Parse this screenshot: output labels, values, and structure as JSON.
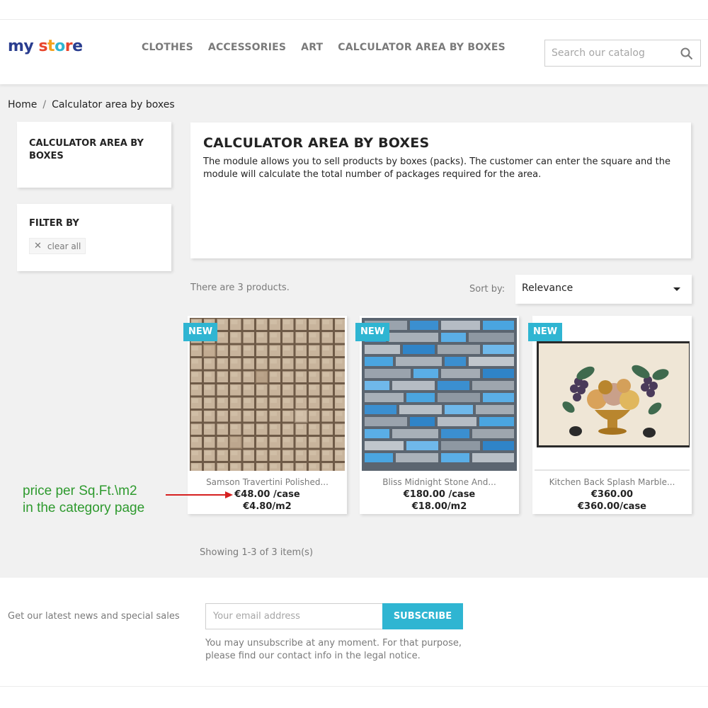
{
  "header": {
    "logo_word1": "my",
    "logo_word2": "store",
    "nav": [
      "CLOTHES",
      "ACCESSORIES",
      "ART",
      "CALCULATOR AREA BY BOXES"
    ],
    "search_placeholder": "Search our catalog"
  },
  "breadcrumb": {
    "home": "Home",
    "separator": "/",
    "current": "Calculator area by boxes"
  },
  "sidebar": {
    "category_title": "CALCULATOR AREA BY BOXES",
    "filter_title": "FILTER BY",
    "clear_all": "clear all"
  },
  "category": {
    "title": "CALCULATOR AREA BY BOXES",
    "description": "The module allows you to sell products by boxes (packs). The customer can enter the square and the module will calculate the total number of packages required for the area."
  },
  "listing": {
    "count_text": "There are 3 products.",
    "sort_label": "Sort by:",
    "sort_value": "Relevance",
    "showing_text": "Showing 1-3 of 3 item(s)"
  },
  "products": [
    {
      "badge": "NEW",
      "name": "Samson Travertini Polished...",
      "price": "€48.00 /case",
      "unit_price": "€4.80/m2"
    },
    {
      "badge": "NEW",
      "name": "Bliss Midnight Stone And...",
      "price": "€180.00 /case",
      "unit_price": "€18.00/m2"
    },
    {
      "badge": "NEW",
      "name": "Kitchen Back Splash Marble...",
      "price": "€360.00",
      "unit_price": "€360.00/case"
    }
  ],
  "annotation": {
    "line1": "price per Sq.Ft.\\m2",
    "line2": "in the category page"
  },
  "footer": {
    "newsletter_label": "Get our latest news and special sales",
    "email_placeholder": "Your email address",
    "subscribe_label": "SUBSCRIBE",
    "unsubscribe_text": "You may unsubscribe at any moment. For that purpose, please find our contact info in the legal notice."
  },
  "colors": {
    "accent": "#2fb5d2",
    "annotation": "#2e9a2e",
    "arrow": "#d62020"
  }
}
